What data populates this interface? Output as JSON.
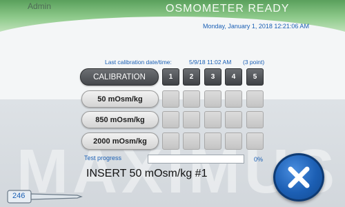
{
  "header": {
    "user": "Admin",
    "status": "OSMOMETER READY",
    "datetime": "Monday, January 1, 2018 12:21:06 AM"
  },
  "watermark": "MAXIMUS",
  "calibration": {
    "label": "Last calibration date/time:",
    "datetime": "5/9/18 11:02 AM",
    "points": "(3 point)"
  },
  "rows": [
    {
      "label": "CALIBRATION",
      "cells": [
        "1",
        "2",
        "3",
        "4",
        "5"
      ]
    },
    {
      "label": "50 mOsm/kg",
      "cells": [
        "",
        "",
        "",
        "",
        ""
      ]
    },
    {
      "label": "850 mOsm/kg",
      "cells": [
        "",
        "",
        "",
        "",
        ""
      ]
    },
    {
      "label": "2000 mOsm/kg",
      "cells": [
        "",
        "",
        "",
        "",
        ""
      ]
    }
  ],
  "progress": {
    "label": "Test progress",
    "value": 0,
    "percent_text": "0%"
  },
  "instruction": "INSERT 50 mOsm/kg #1",
  "counter": "246",
  "icons": {
    "close": "close-icon",
    "counter": "probe-icon"
  },
  "colors": {
    "header_green": "#5aa05c",
    "text_blue": "#1a5fb4",
    "close_blue": "#1c5fb4",
    "progress_fill": "#3c8a45"
  }
}
